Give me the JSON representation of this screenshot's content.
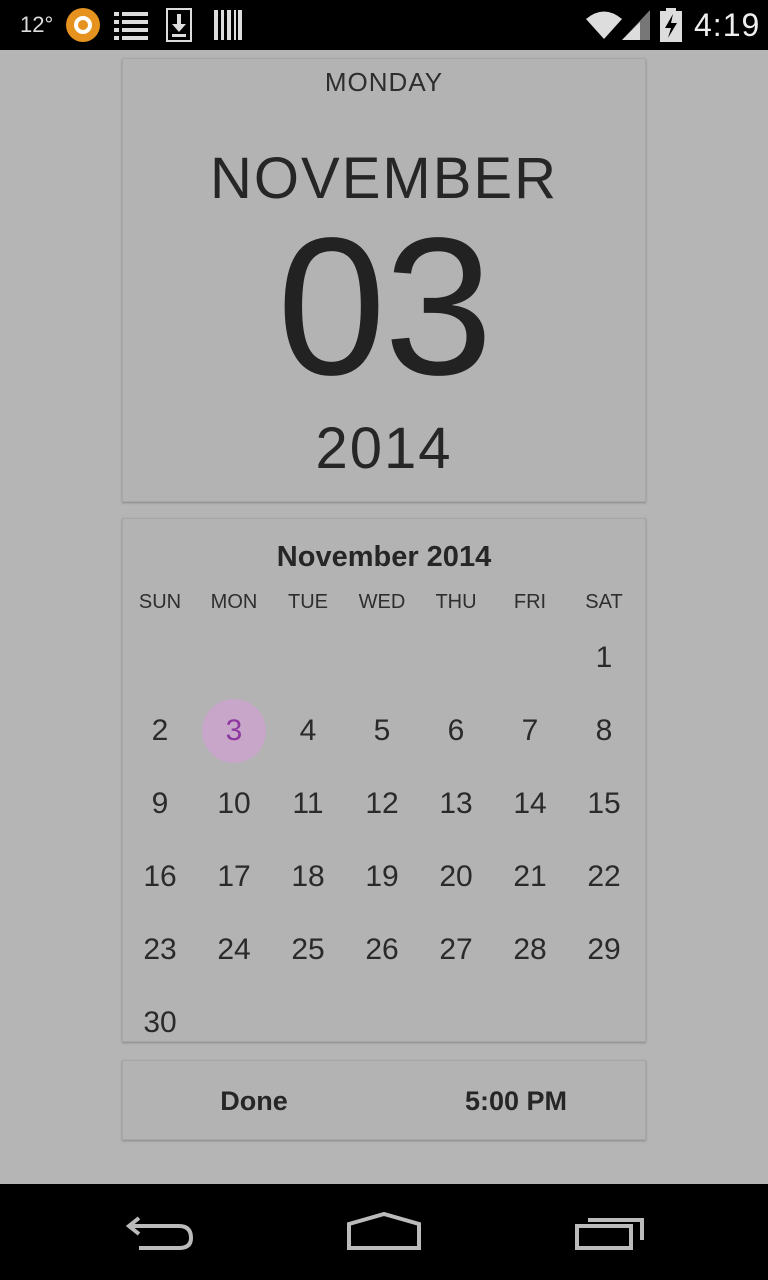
{
  "status_bar": {
    "temperature": "12°",
    "time": "4:19",
    "icons": [
      "a-app-icon",
      "list-icon",
      "download-icon",
      "barcode-icon",
      "wifi-icon",
      "signal-icon",
      "battery-charging-icon"
    ]
  },
  "date_header": {
    "weekday": "MONDAY",
    "month": "NOVEMBER",
    "day": "03",
    "year": "2014"
  },
  "calendar": {
    "title": "November 2014",
    "weekdays": [
      "SUN",
      "MON",
      "TUE",
      "WED",
      "THU",
      "FRI",
      "SAT"
    ],
    "weeks": [
      [
        "",
        "",
        "",
        "",
        "",
        "",
        "1"
      ],
      [
        "2",
        "3",
        "4",
        "5",
        "6",
        "7",
        "8"
      ],
      [
        "9",
        "10",
        "11",
        "12",
        "13",
        "14",
        "15"
      ],
      [
        "16",
        "17",
        "18",
        "19",
        "20",
        "21",
        "22"
      ],
      [
        "23",
        "24",
        "25",
        "26",
        "27",
        "28",
        "29"
      ],
      [
        "30",
        "",
        "",
        "",
        "",
        "",
        ""
      ]
    ],
    "selected_day": "3",
    "selected_color": "#8e37a0"
  },
  "actions": {
    "done_label": "Done",
    "time_label": "5:00 PM"
  },
  "nav_bar": {
    "icons": [
      "back-icon",
      "home-icon",
      "recents-icon"
    ]
  }
}
